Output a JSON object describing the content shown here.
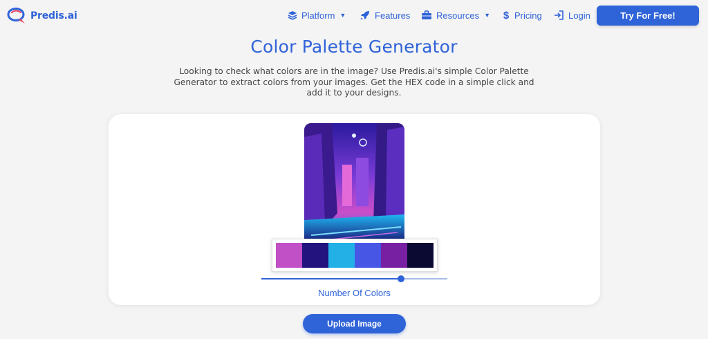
{
  "brand": {
    "name": "Predis.ai",
    "color": "#2f63d8"
  },
  "nav": {
    "items": [
      {
        "label": "Platform",
        "icon": "layers-icon",
        "has_dropdown": true
      },
      {
        "label": "Features",
        "icon": "rocket-icon",
        "has_dropdown": false
      },
      {
        "label": "Resources",
        "icon": "briefcase-icon",
        "has_dropdown": true
      },
      {
        "label": "Pricing",
        "icon": "dollar-icon",
        "has_dropdown": false
      },
      {
        "label": "Login",
        "icon": "login-icon",
        "has_dropdown": false
      }
    ],
    "cta_label": "Try For Free!"
  },
  "hero": {
    "title": "Color Palette Generator",
    "description": "Looking to check what colors are in the image? Use Predis.ai's simple Color Palette Generator to extract colors from your images. Get the HEX code in a simple click and add it to your designs."
  },
  "tool": {
    "palette": [
      "#c14fc6",
      "#22137e",
      "#22b0e6",
      "#4856e5",
      "#7720a2",
      "#0b0a33"
    ],
    "slider_value": 0.75,
    "slider_label": "Number Of Colors",
    "upload_label": "Upload Image"
  }
}
